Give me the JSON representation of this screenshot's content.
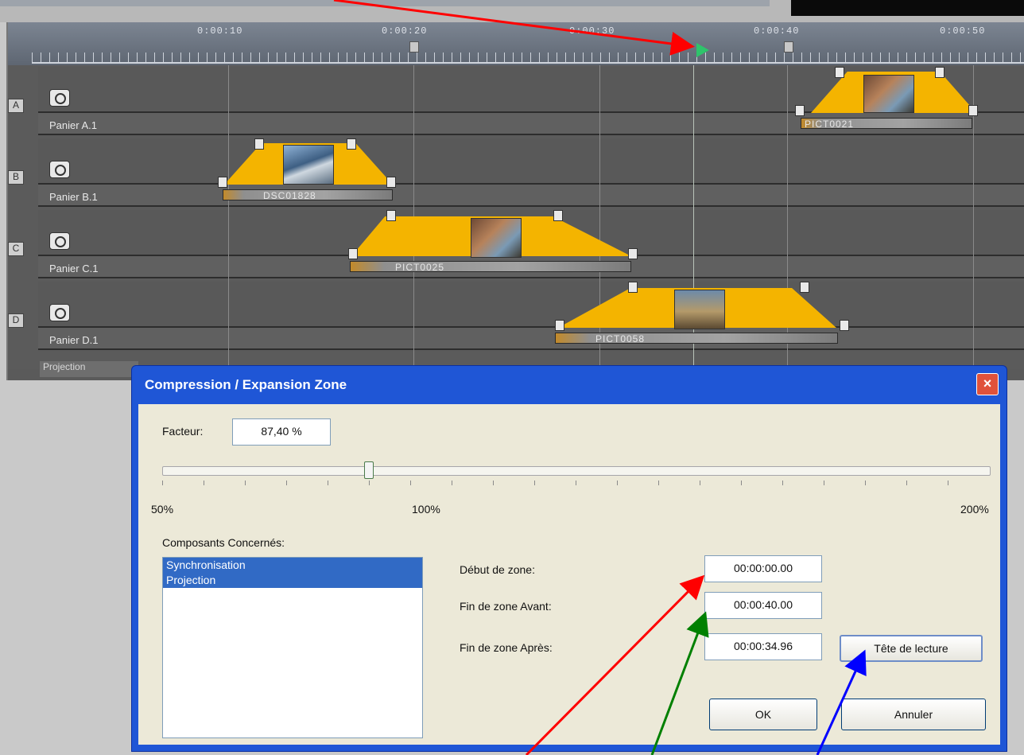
{
  "ruler": {
    "ticks": [
      "0:00:10",
      "0:00:20",
      "0:00:30",
      "0:00:40",
      "0:00:50"
    ]
  },
  "tracks": [
    {
      "letter": "A",
      "name": "Panier A.1"
    },
    {
      "letter": "B",
      "name": "Panier B.1"
    },
    {
      "letter": "C",
      "name": "Panier C.1"
    },
    {
      "letter": "D",
      "name": "Panier D.1"
    }
  ],
  "clips": [
    {
      "name": "PICT0021"
    },
    {
      "name": "DSC01828"
    },
    {
      "name": "PICT0025"
    },
    {
      "name": "PICT0058"
    }
  ],
  "projection_label": "Projection",
  "dialog": {
    "title": "Compression / Expansion Zone",
    "close_icon": "×",
    "factor_label": "Facteur:",
    "factor_value": "87,40 %",
    "slider_value_percent": 87.4,
    "slider_labels": {
      "min": "50%",
      "mid": "100%",
      "max": "200%"
    },
    "components_label": "Composants Concernés:",
    "components": [
      "Synchronisation",
      "Projection"
    ],
    "zone_start_label": "Début de zone:",
    "zone_start_value": "00:00:00.00",
    "zone_end_before_label": "Fin de zone Avant:",
    "zone_end_before_value": "00:00:40.00",
    "zone_end_after_label": "Fin de zone Après:",
    "zone_end_after_value": "00:00:34.96",
    "playhead_button": "Tête de lecture",
    "ok_button": "OK",
    "cancel_button": "Annuler"
  },
  "colors": {
    "clip": "#f4b400",
    "dialog_title_bar": "#1f56d6",
    "selection": "#316ac5",
    "arrow_red": "#ff0000",
    "arrow_green": "#008000",
    "arrow_blue": "#0000ff"
  }
}
